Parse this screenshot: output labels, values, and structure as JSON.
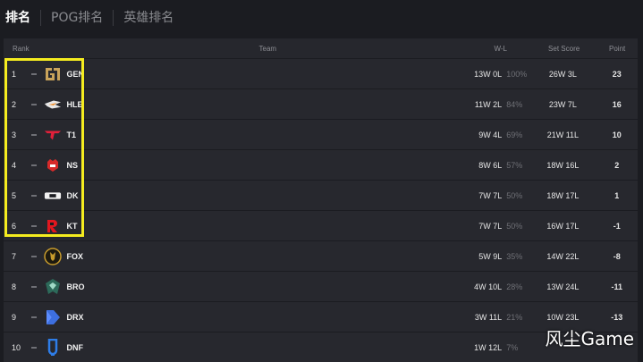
{
  "tabs": [
    "排名",
    "POG排名",
    "英雄排名"
  ],
  "headers": {
    "rank": "Rank",
    "team": "Team",
    "wl": "W-L",
    "set_score": "Set Score",
    "point": "Point"
  },
  "rows": [
    {
      "rank": "1",
      "team": "GEN",
      "wl": "13W 0L",
      "pct": "100%",
      "set": "26W 3L",
      "point": "23",
      "logo": "gen-logo-icon"
    },
    {
      "rank": "2",
      "team": "HLE",
      "wl": "11W 2L",
      "pct": "84%",
      "set": "23W 7L",
      "point": "16",
      "logo": "hle-logo-icon"
    },
    {
      "rank": "3",
      "team": "T1",
      "wl": "9W 4L",
      "pct": "69%",
      "set": "21W 11L",
      "point": "10",
      "logo": "t1-logo-icon"
    },
    {
      "rank": "4",
      "team": "NS",
      "wl": "8W 6L",
      "pct": "57%",
      "set": "18W 16L",
      "point": "2",
      "logo": "ns-logo-icon"
    },
    {
      "rank": "5",
      "team": "DK",
      "wl": "7W 7L",
      "pct": "50%",
      "set": "18W 17L",
      "point": "1",
      "logo": "dk-logo-icon"
    },
    {
      "rank": "6",
      "team": "KT",
      "wl": "7W 7L",
      "pct": "50%",
      "set": "16W 17L",
      "point": "-1",
      "logo": "kt-logo-icon"
    },
    {
      "rank": "7",
      "team": "FOX",
      "wl": "5W 9L",
      "pct": "35%",
      "set": "14W 22L",
      "point": "-8",
      "logo": "fox-logo-icon"
    },
    {
      "rank": "8",
      "team": "BRO",
      "wl": "4W 10L",
      "pct": "28%",
      "set": "13W 24L",
      "point": "-11",
      "logo": "bro-logo-icon"
    },
    {
      "rank": "9",
      "team": "DRX",
      "wl": "3W 11L",
      "pct": "21%",
      "set": "10W 23L",
      "point": "-13",
      "logo": "drx-logo-icon"
    },
    {
      "rank": "10",
      "team": "DNF",
      "wl": "1W 12L",
      "pct": "7%",
      "set": "",
      "point": "",
      "logo": "dnf-logo-icon"
    }
  ],
  "watermark": "风尘Game",
  "colors": {
    "highlight": "#f5ec1f",
    "background": "#1b1c21",
    "row": "#27282e"
  }
}
